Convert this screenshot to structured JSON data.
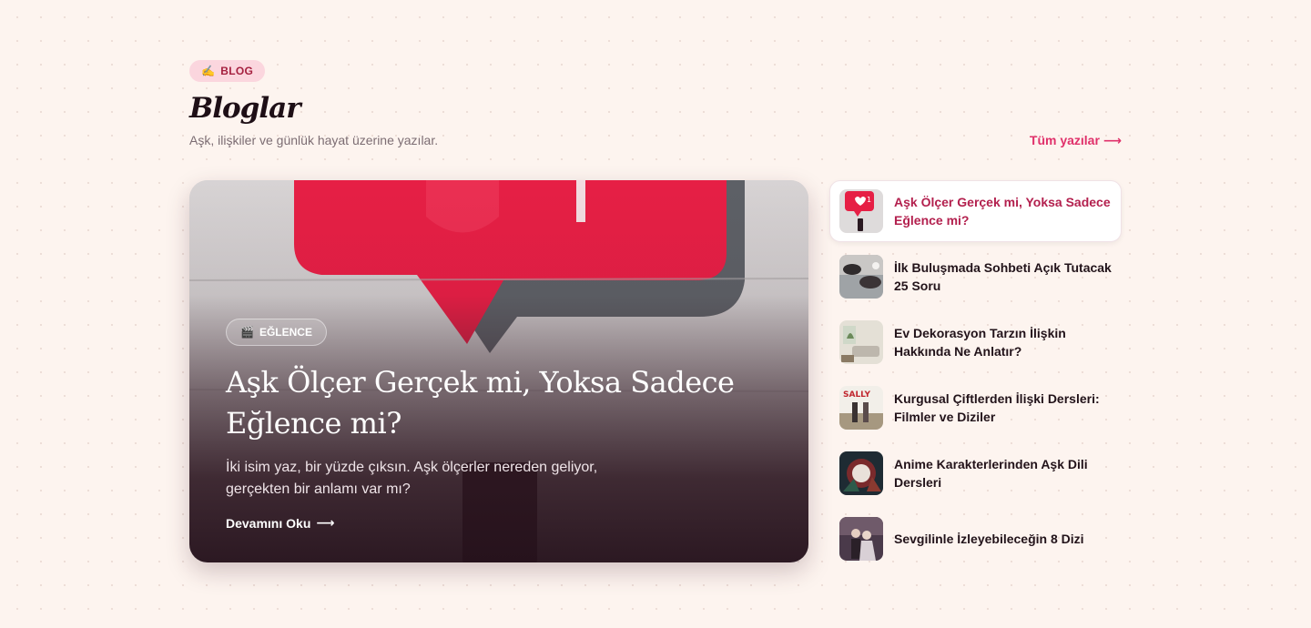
{
  "section": {
    "badge": {
      "emoji": "✍️",
      "label": "BLOG"
    },
    "title": "Bloglar",
    "subtitle": "Aşk, ilişkiler ve günlük hayat üzerine yazılar.",
    "all_link": "Tüm yazılar",
    "all_link_arrow": "⟶"
  },
  "featured": {
    "category_emoji": "🎬",
    "category": "EĞLENCE",
    "title": "Aşk Ölçer Gerçek mi, Yoksa Sadece Eğlence mi?",
    "description": "İki isim yaz, bir yüzde çıksın. Aşk ölçerler nereden geliyor, gerçekten bir anlamı var mı?",
    "read_more": "Devamını Oku",
    "read_more_arrow": "⟶"
  },
  "side_posts": [
    {
      "title": "Aşk Ölçer Gerçek mi, Yoksa Sadece Eğlence mi?",
      "thumb": "love-meter-thumb",
      "active": true
    },
    {
      "title": "İlk Buluşmada Sohbeti Açık Tutacak 25 Soru",
      "thumb": "first-date-thumb",
      "active": false
    },
    {
      "title": "Ev Dekorasyon Tarzın İlişkin Hakkında Ne Anlatır?",
      "thumb": "home-decor-thumb",
      "active": false
    },
    {
      "title": "Kurgusal Çiftlerden İlişki Dersleri: Filmler ve Diziler",
      "thumb": "movie-poster-thumb",
      "active": false
    },
    {
      "title": "Anime Karakterlerinden Aşk Dili Dersleri",
      "thumb": "anime-thumb",
      "active": false
    },
    {
      "title": "Sevgilinle İzleyebileceğin 8 Dizi",
      "thumb": "series-couple-thumb",
      "active": false
    }
  ],
  "thumb_text": {
    "poster": "SALLY",
    "like_count": "1"
  },
  "colors": {
    "background": "#fdf4ef",
    "accent": "#e0306a",
    "badge_bg": "#fbd6de",
    "active_title": "#b3204e"
  }
}
